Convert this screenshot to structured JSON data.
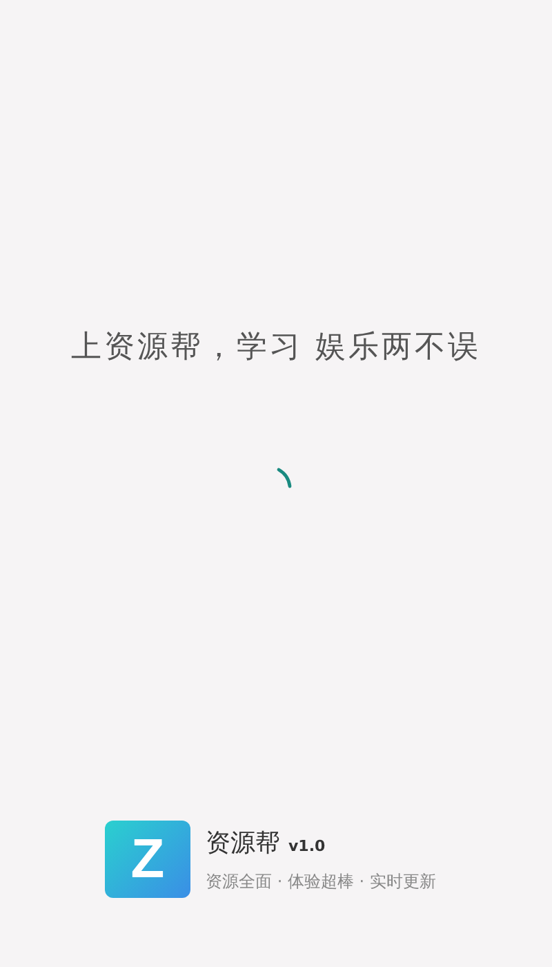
{
  "slogan": "上资源帮，学习 娱乐两不误",
  "app": {
    "logo_letter": "Z",
    "name": "资源帮",
    "version": "v1.0",
    "tagline": "资源全面 · 体验超棒 · 实时更新"
  }
}
